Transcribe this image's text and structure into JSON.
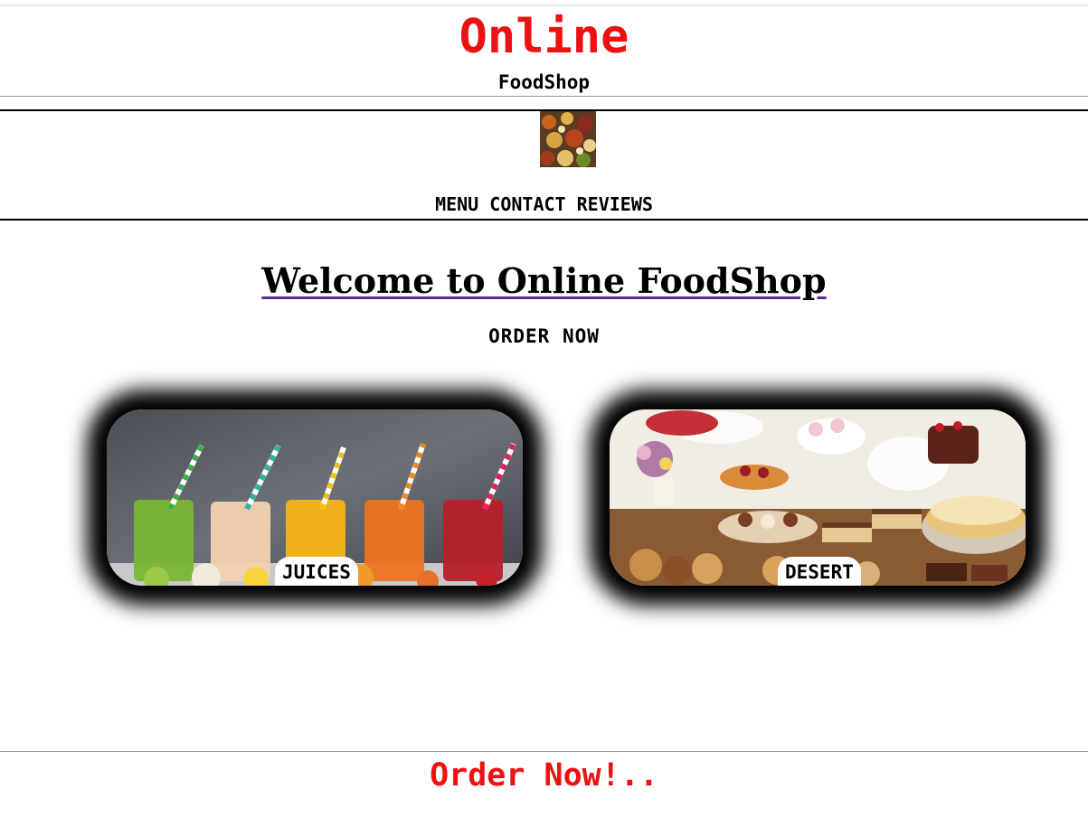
{
  "header": {
    "brand_main": "Online",
    "brand_sub": "FoodShop",
    "logo_icon": "food-platter-logo"
  },
  "nav": {
    "items": [
      {
        "label": "MENU"
      },
      {
        "label": "CONTACT"
      },
      {
        "label": "REVIEWS"
      }
    ]
  },
  "main": {
    "welcome": "Welcome to Online FoodShop",
    "order_now": "ORDER NOW",
    "categories": [
      {
        "label": "JUICES"
      },
      {
        "label": "DESERT"
      }
    ]
  },
  "footer": {
    "text": "Order Now!.."
  },
  "colors": {
    "brand_red": "#ee1111",
    "underline_purple": "#5a2a8a",
    "shadow": "#000000"
  }
}
